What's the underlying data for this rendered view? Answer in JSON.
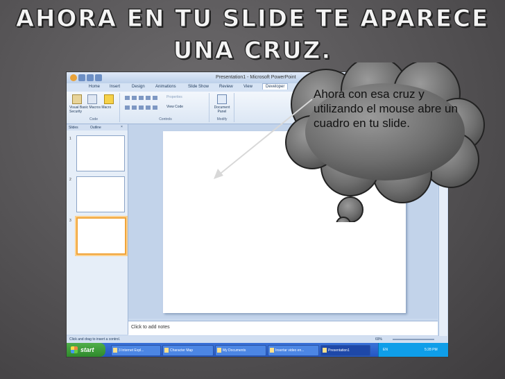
{
  "slide_title": {
    "line1": "AHORA EN TU SLIDE TE APARECE",
    "line2": "UNA CRUZ."
  },
  "callout": {
    "text": "Ahora con esa cruz y utilizando el mouse abre un cuadro en tu slide."
  },
  "app": {
    "window_title": "Presentation1 - Microsoft PowerPoint",
    "tabs": [
      "Home",
      "Insert",
      "Design",
      "Animations",
      "Slide Show",
      "Review",
      "View",
      "Developer"
    ],
    "active_tab": "Developer",
    "groups": [
      {
        "label": "Code",
        "items": [
          "Visual Basic",
          "Macros",
          "Macro Security"
        ]
      },
      {
        "label": "Controls",
        "items": [
          "Properties",
          "View Code"
        ]
      },
      {
        "label": "Modify",
        "items": [
          "Document Panel"
        ]
      }
    ],
    "panel_tabs": [
      "Slides",
      "Outline"
    ],
    "panel_close": "×",
    "slide_numbers": [
      "1",
      "2",
      "3"
    ],
    "notes_placeholder": "Click to add notes",
    "status_text": "Click and drag to insert a control.",
    "zoom": "69%"
  },
  "taskbar": {
    "start_label": "start",
    "buttons": [
      "3 Internet Expl...",
      "Character Map",
      "My Documents",
      "Insertar video en...",
      "Presentation1"
    ],
    "language": "EN",
    "clock": "5:28 PM"
  },
  "colors": {
    "background": "#545254",
    "accent_selected_thumb": "#f0a43a",
    "ribbon": "#dbe6f4",
    "taskbar": "#2556c2"
  }
}
